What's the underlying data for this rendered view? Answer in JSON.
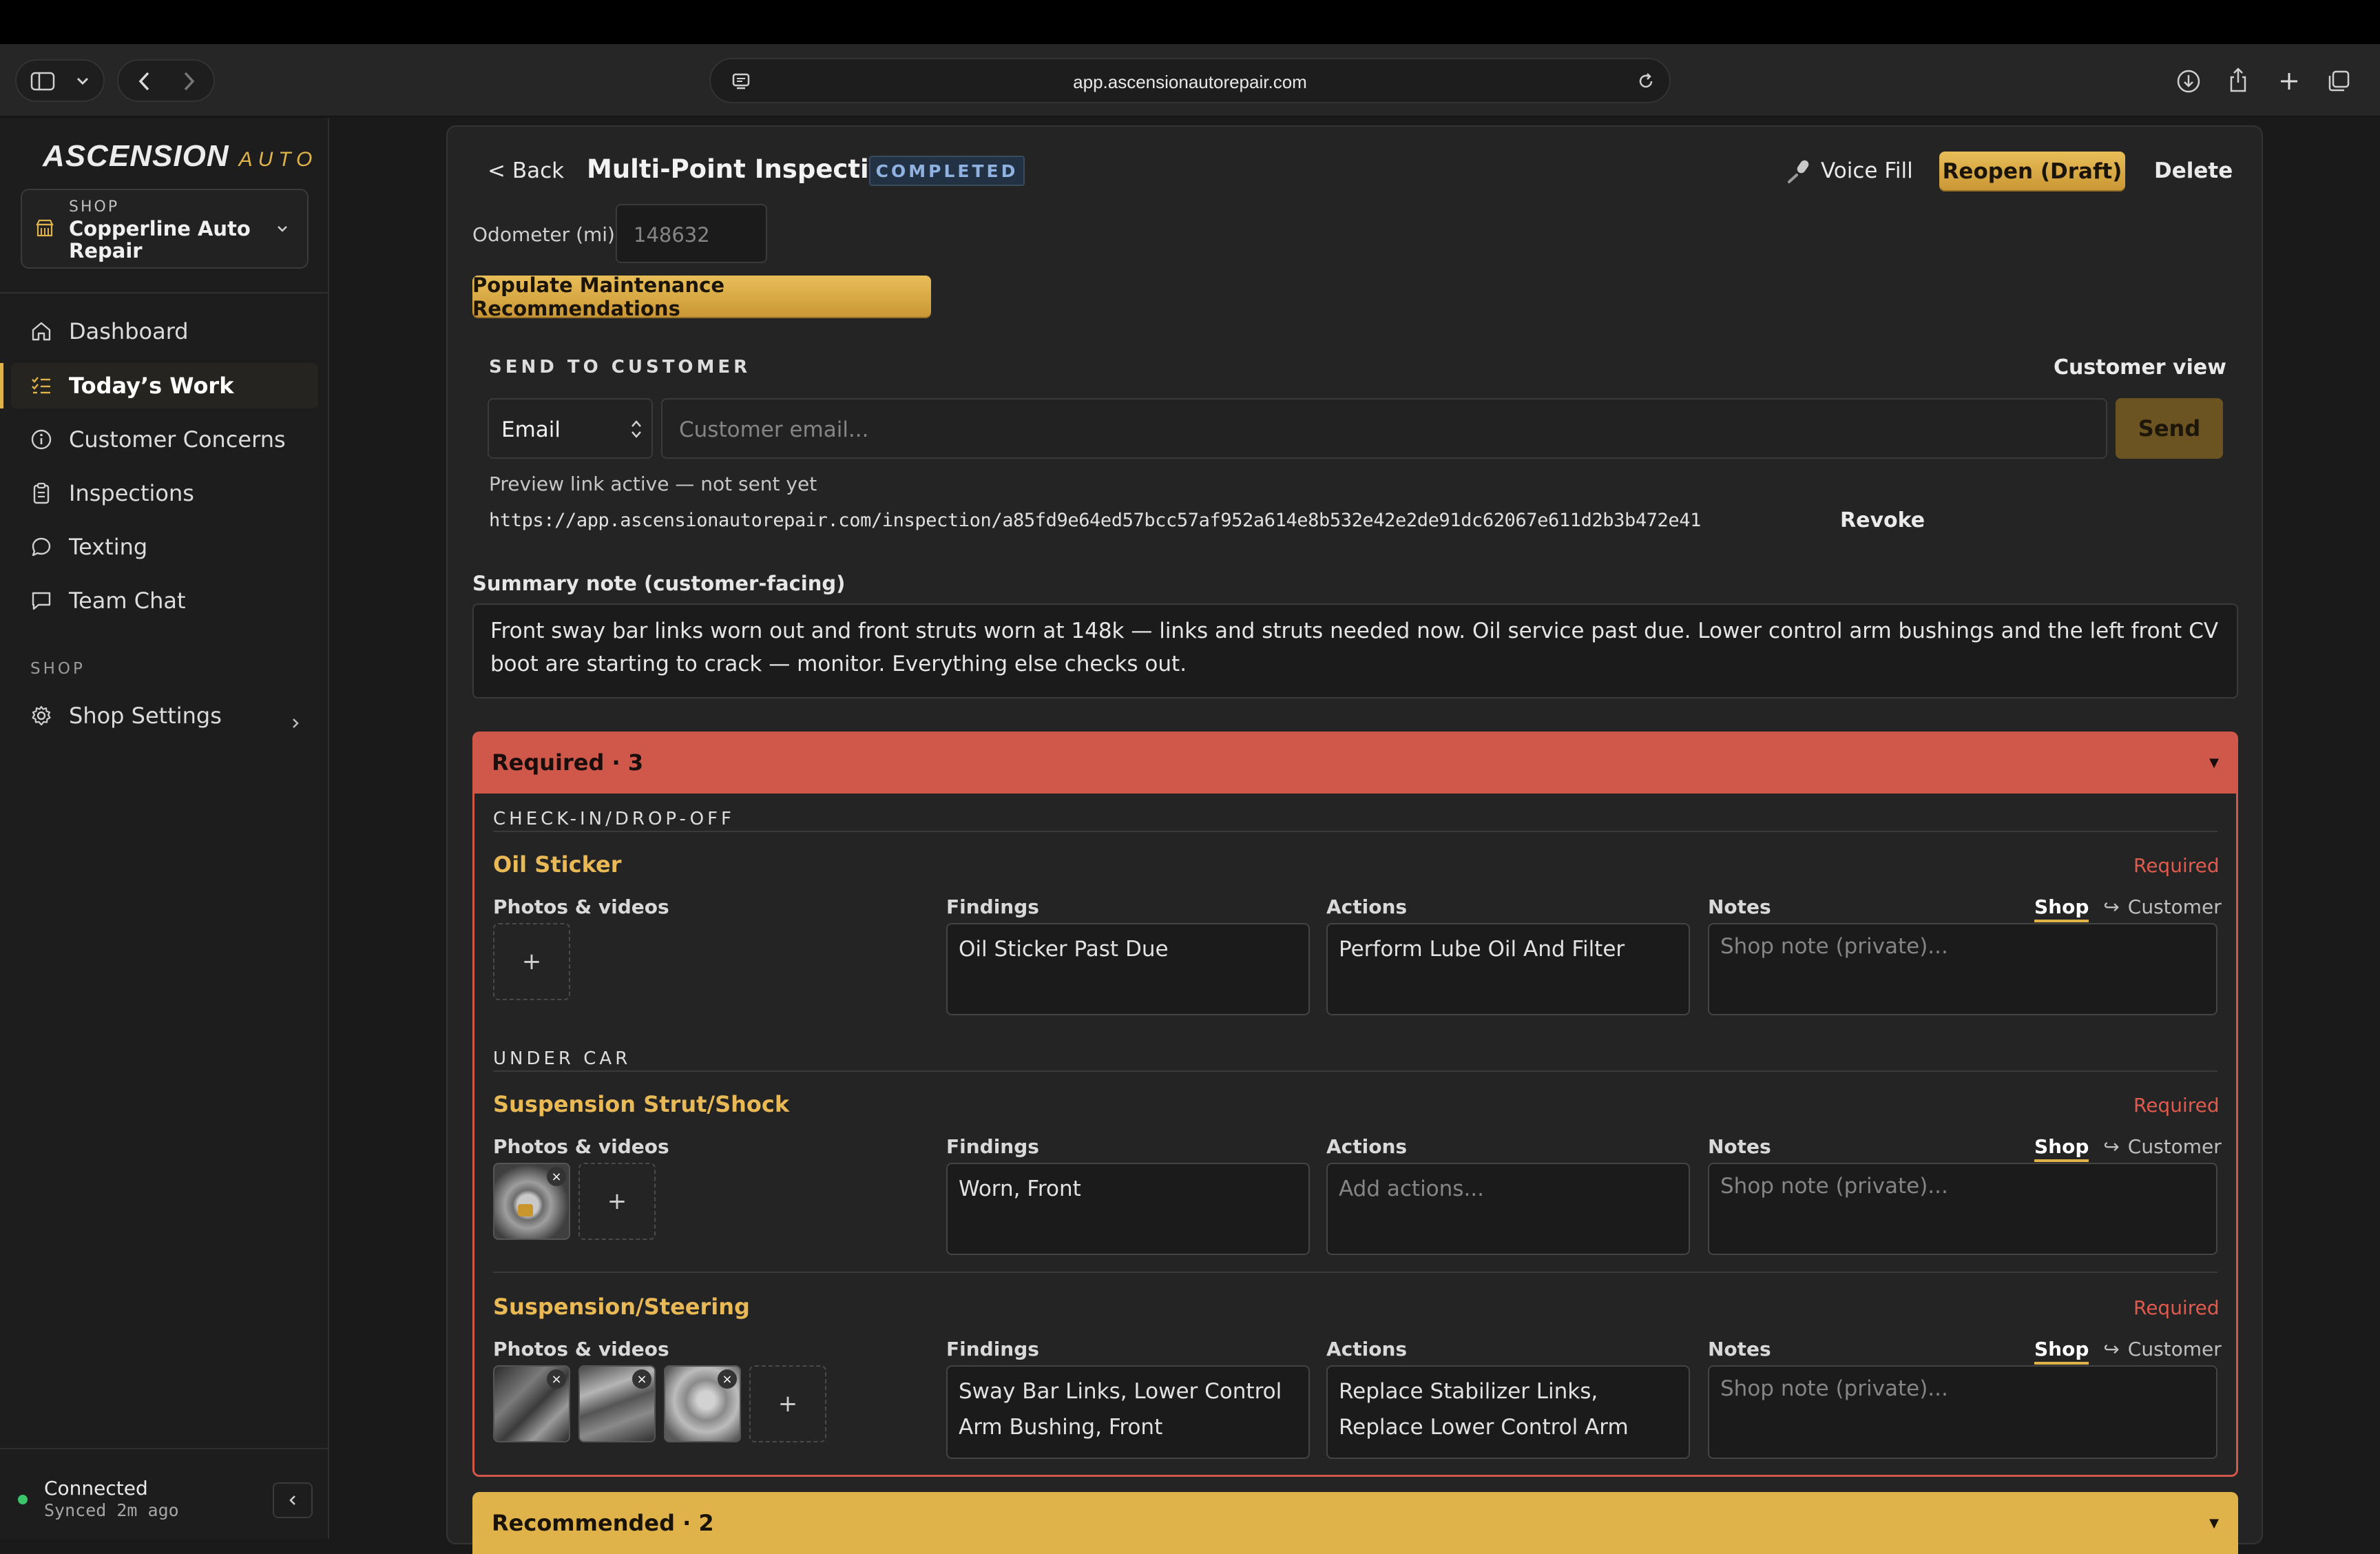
{
  "browser": {
    "url": "app.ascensionautorepair.com"
  },
  "sidebar": {
    "logo_main": "ASCENSION",
    "logo_sub": "AUTO",
    "shop_label": "SHOP",
    "shop_name": "Copperline Auto Repair",
    "nav": [
      {
        "label": "Dashboard",
        "icon": "home-icon"
      },
      {
        "label": "Today’s Work",
        "icon": "checklist-icon"
      },
      {
        "label": "Customer Concerns",
        "icon": "info-icon"
      },
      {
        "label": "Inspections",
        "icon": "clipboard-icon"
      },
      {
        "label": "Texting",
        "icon": "message-bubble-icon"
      },
      {
        "label": "Team Chat",
        "icon": "chat-square-icon"
      }
    ],
    "section_label": "SHOP",
    "settings_label": "Shop Settings",
    "status_label": "Connected",
    "status_sub": "Synced 2m ago"
  },
  "header": {
    "back": "< Back",
    "title": "Multi-Point Inspection",
    "badge": "COMPLETED",
    "voice_fill": "Voice Fill",
    "reopen": "Reopen (Draft)",
    "delete": "Delete"
  },
  "odometer": {
    "label": "Odometer (mi)",
    "value": "148632"
  },
  "populate_button": "Populate Maintenance Recommendations",
  "send": {
    "heading": "SEND TO CUSTOMER",
    "customer_view": "Customer view",
    "method": "Email",
    "email_placeholder": "Customer email...",
    "send_button": "Send",
    "preview_status": "Preview link active — not sent yet",
    "link": "https://app.ascensionautorepair.com/inspection/a85fd9e64ed57bcc57af952a614e8b532e42e2de91dc62067e611d2b3b472e41",
    "revoke": "Revoke"
  },
  "summary": {
    "label": "Summary note (customer-facing)",
    "text": "Front sway bar links worn out and front struts worn at 148k — links and struts needed now. Oil service past due. Lower control arm bushings and the left front CV boot are starting to crack — monitor. Everything else checks out."
  },
  "required": {
    "band_label": "Required · 3",
    "groups": [
      {
        "name": "CHECK-IN/DROP-OFF"
      },
      {
        "name": "UNDER CAR"
      }
    ],
    "col_photos": "Photos & videos",
    "col_findings": "Findings",
    "col_actions": "Actions",
    "col_notes": "Notes",
    "tag": "Required",
    "toggle_shop": "Shop",
    "toggle_customer": "Customer",
    "notes_placeholder": "Shop note (private)...",
    "items": [
      {
        "title": "Oil Sticker",
        "findings": "Oil Sticker Past Due",
        "actions": "Perform Lube Oil And Filter"
      },
      {
        "title": "Suspension Strut/Shock",
        "findings": "Worn, Front",
        "actions_placeholder": "Add actions..."
      },
      {
        "title": "Suspension/Steering",
        "findings": "Sway Bar Links, Lower Control Arm Bushing, Front",
        "actions": "Replace Stabilizer Links, Replace Lower Control Arm"
      }
    ]
  },
  "recommended": {
    "band_label": "Recommended · 2"
  },
  "colors": {
    "accent": "#e0b34a",
    "required": "#d0584b",
    "recommended": "#e0b34a",
    "connected": "#3cc46a"
  }
}
